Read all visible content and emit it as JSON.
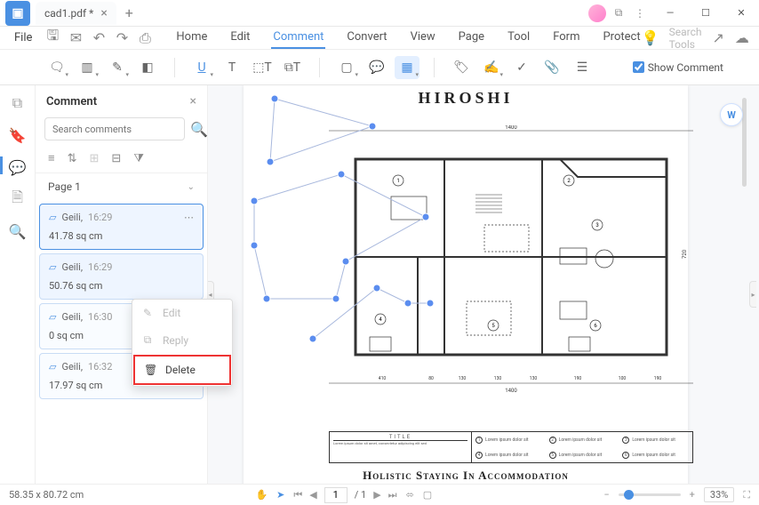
{
  "tab": {
    "title": "cad1.pdf *"
  },
  "menu": {
    "file": "File",
    "tabs": [
      "Home",
      "Edit",
      "Comment",
      "Convert",
      "View",
      "Page",
      "Tool",
      "Form",
      "Protect"
    ],
    "active": "Comment",
    "search_placeholder": "Search Tools"
  },
  "toolbar": {
    "show_comment": "Show Comment"
  },
  "panel": {
    "title": "Comment",
    "search_placeholder": "Search comments",
    "page_label": "Page 1",
    "comments": [
      {
        "author": "Geili,",
        "time": "16:29",
        "body": "41.78 sq cm"
      },
      {
        "author": "Geili,",
        "time": "16:29",
        "body": "50.76 sq cm"
      },
      {
        "author": "Geili,",
        "time": "16:30",
        "body": "0 sq cm"
      },
      {
        "author": "Geili,",
        "time": "16:32",
        "body": "17.97 sq cm"
      }
    ]
  },
  "context_menu": {
    "edit": "Edit",
    "reply": "Reply",
    "delete": "Delete"
  },
  "document": {
    "title": "HIROSHI",
    "subtitle": "Holistic Staying In Accommodation",
    "legend_title": "TITLE",
    "legend_text": "Lorem ipsum dolor sit",
    "dims": {
      "top": "1400",
      "bottom": "1400",
      "side": "720",
      "b1": "410",
      "b2": "80",
      "b3": "130",
      "b4": "130",
      "b5": "130",
      "b6": "190",
      "b7": "100",
      "b8": "190"
    }
  },
  "status": {
    "coords": "58.35 x 80.72 cm",
    "page": "1",
    "pages": "/ 1",
    "zoom": "33%"
  }
}
